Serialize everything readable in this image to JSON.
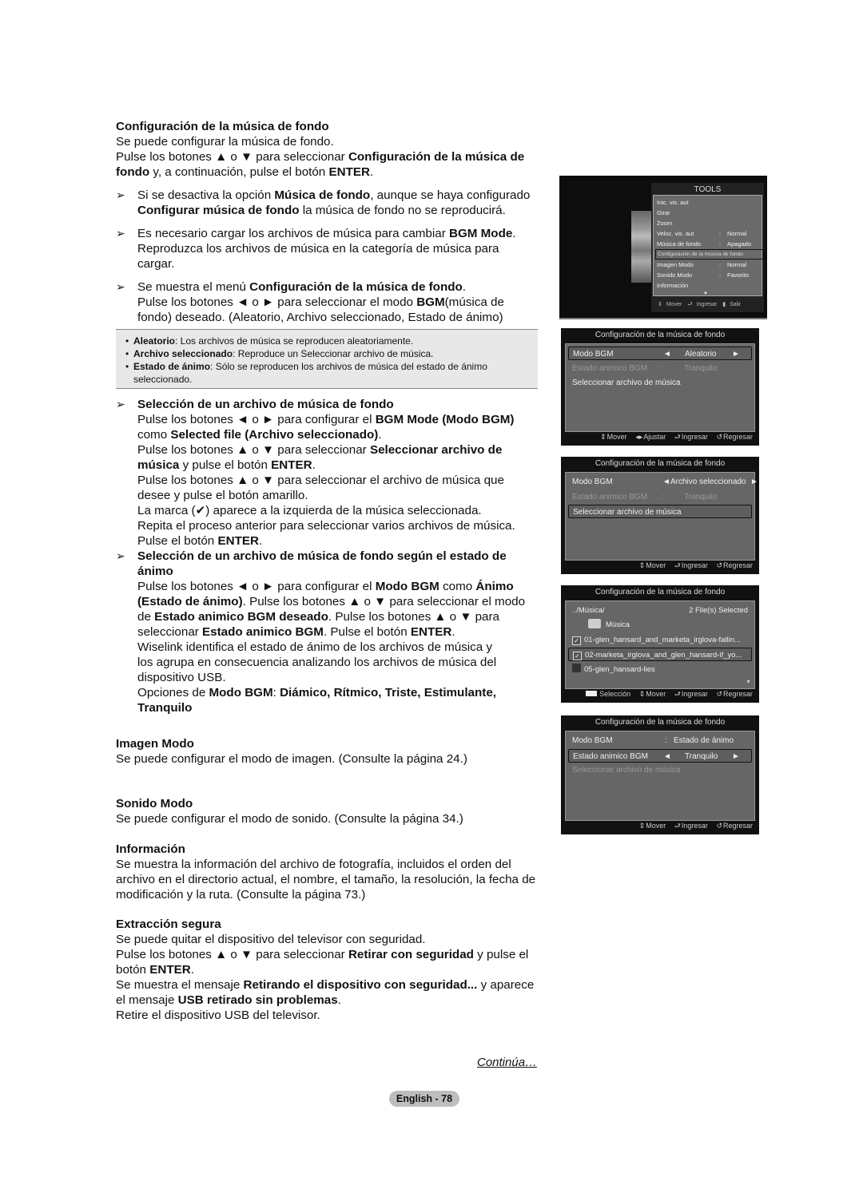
{
  "left": {
    "section1": {
      "heading": "Configuración de la música de fondo",
      "line1": "Se puede configurar la música de fondo.",
      "line2_a": "Pulse los botones ▲ o ▼ para seleccionar ",
      "line2_b": "Configuración de la música de",
      "line3_b": "fondo",
      "line3_a": " y, a continuación, pulse el botón ",
      "line3_c": "ENTER",
      "line3_d": "."
    },
    "notes": [
      {
        "p1a": "Si se desactiva la opción ",
        "p1b": "Música de fondo",
        "p1c": ", aunque se haya configurado",
        "p2a": "Configurar música de fondo",
        "p2b": " la música de fondo no se reproducirá."
      },
      {
        "p1a": "Es necesario cargar los archivos de música para cambiar ",
        "p1b": "BGM Mode",
        "p1c": ".",
        "p2": "Reproduzca los archivos de música en la categoría de música para",
        "p3": "cargar."
      },
      {
        "p1a": "Se muestra el menú ",
        "p1b": "Configuración de la música de fondo",
        "p1c": ".",
        "p2a": "Pulse los botones ◄ o ► para seleccionar el modo ",
        "p2b": "BGM",
        "p2c": "(música de",
        "p3": "fondo) deseado. (Aleatorio, Archivo seleccionado, Estado de ánimo)"
      }
    ],
    "bullets": [
      {
        "term": "Aleatorio",
        "text": ": Los archivos de música se reproducen aleatoriamente."
      },
      {
        "term": "Archivo seleccionado",
        "text": ": Reproduce un Seleccionar archivo de música."
      },
      {
        "term": "Estado de ánimo",
        "text": ": Sólo se reproducen los archivos de música del estado de ánimo",
        "text2": "seleccionado."
      }
    ],
    "select_file": {
      "heading": "Selección de un archivo de música de fondo",
      "l1a": "Pulse los botones ◄ o ► para configurar el ",
      "l1b": "BGM Mode (Modo BGM)",
      "l2a": "como ",
      "l2b": "Selected file (Archivo seleccionado)",
      "l2c": ".",
      "l3a": "Pulse los botones ▲ o ▼ para seleccionar ",
      "l3b": "Seleccionar archivo de",
      "l4a": "música",
      "l4b": " y pulse el botón ",
      "l4c": "ENTER",
      "l4d": ".",
      "l5": "Pulse los botones ▲ o ▼ para seleccionar el archivo de música que",
      "l6": "desee y pulse el botón amarillo.",
      "l7": "La marca (✔) aparece a la izquierda de la música seleccionada.",
      "l8": "Repita el proceso anterior para seleccionar varios archivos de música.",
      "l9a": "Pulse el botón ",
      "l9b": "ENTER",
      "l9c": "."
    },
    "mood": {
      "heading1": "Selección de un archivo de música de fondo según el estado de",
      "heading2": "ánimo",
      "l1a": "Pulse los botones ◄ o ► para configurar el ",
      "l1b": "Modo BGM",
      "l1c": " como ",
      "l1d": "Ánimo",
      "l2a": "(Estado de ánimo)",
      "l2b": ". Pulse los botones ▲ o ▼ para seleccionar el modo",
      "l3a": "de ",
      "l3b": "Estado animico BGM deseado",
      "l3c": ". Pulse los botones ▲ o ▼ para",
      "l4a": "seleccionar ",
      "l4b": "Estado animico BGM",
      "l4c": ". Pulse el botón ",
      "l4d": "ENTER",
      "l4e": ".",
      "l5": "Wiselink identifica el estado de ánimo de los archivos de música y",
      "l6": "los agrupa en consecuencia analizando los archivos de música del",
      "l7": "dispositivo USB.",
      "l8a": "Opciones de ",
      "l8b": "Modo BGM",
      "l8c": ": ",
      "l8d": "Diámico, Rítmico, Triste, Estimulante,",
      "l9": "Tranquilo"
    },
    "imagen": {
      "heading": "Imagen Modo",
      "text": "Se puede configurar el modo de imagen. (Consulte la página 24.)"
    },
    "sonido": {
      "heading": "Sonido Modo",
      "text": "Se puede configurar el modo de sonido. (Consulte la página 34.)"
    },
    "info": {
      "heading": "Información",
      "l1": "Se muestra la información del archivo de fotografía, incluidos el orden del",
      "l2": "archivo en el directorio actual, el nombre, el tamaño, la resolución, la fecha de",
      "l3": "modificación y la ruta. (Consulte la página 73.)"
    },
    "extract": {
      "heading": "Extracción segura",
      "l1": "Se puede quitar el dispositivo del televisor con seguridad.",
      "l2a": "Pulse los botones ▲ o ▼ para seleccionar ",
      "l2b": "Retirar con seguridad",
      "l2c": " y pulse el",
      "l3a": "botón ",
      "l3b": "ENTER",
      "l3c": ".",
      "l4a": "Se muestra el mensaje ",
      "l4b": "Retirando el dispositivo con seguridad...",
      "l4c": " y aparece",
      "l5a": "el mensaje ",
      "l5b": "USB retirado sin problemas",
      "l5c": ".",
      "l6": "Retire el dispositivo USB del televisor."
    },
    "note_arrow": "➢"
  },
  "tools_menu": {
    "title": "TOOLS",
    "items": [
      {
        "label": "Inic. vis. aut",
        "value": ""
      },
      {
        "label": "Girar",
        "value": ""
      },
      {
        "label": "Zoom",
        "value": ""
      },
      {
        "label": "Veloc. vis. aut",
        "value": "Normal"
      },
      {
        "label": "Música de fondo",
        "value": "Apagado"
      },
      {
        "label": "Configuración de la música de fondo",
        "value": "",
        "selected": true
      },
      {
        "label": "Imagen Modo",
        "value": "Normal"
      },
      {
        "label": "Sonido Modo",
        "value": "Favorito"
      },
      {
        "label": "Información",
        "value": ""
      }
    ],
    "footer": {
      "move": "Mover",
      "enter": "Ingresar",
      "exit": "Salir"
    }
  },
  "screens": [
    {
      "title": "Configuración de la música de fondo",
      "rows": [
        {
          "label": "Modo BGM",
          "value": "Aleatorio"
        },
        {
          "label": "Estado animico BGM",
          "value": "Tranquilo"
        },
        {
          "label": "Seleccionar archivo de música"
        }
      ],
      "footer": {
        "move": "Mover",
        "adjust": "Ajustar",
        "enter": "Ingresar",
        "back": "Regresar"
      }
    },
    {
      "title": "Configuración de la música de fondo",
      "rows": [
        {
          "label": "Modo BGM",
          "value": "Archivo seleccionado"
        },
        {
          "label": "Estado animico BGM",
          "value": "Tranquilo"
        },
        {
          "label": "Seleccionar archivo de música"
        }
      ],
      "footer": {
        "move": "Mover",
        "enter": "Ingresar",
        "back": "Regresar"
      }
    },
    {
      "title": "Configuración de la música de fondo",
      "path": "../Música/",
      "selected_count": "2 File(s) Selected",
      "folder": "Música",
      "files": [
        {
          "name": "01-glen_hansard_and_marketa_irglova-fallin...",
          "checked": true
        },
        {
          "name": "02-marketa_irglova_and_glen_hansard-if_yo...",
          "checked": true
        },
        {
          "name": "05-glen_hansard-lies",
          "checked": false
        }
      ],
      "footer": {
        "select": "Selección",
        "move": "Mover",
        "enter": "Ingresar",
        "back": "Regresar"
      }
    },
    {
      "title": "Configuración de la música de fondo",
      "rows": [
        {
          "label": "Modo BGM",
          "value": "Estado de ánimo"
        },
        {
          "label": "Estado animico BGM",
          "value": "Tranquilo"
        },
        {
          "label": "Seleccionar archivo de música"
        }
      ],
      "footer": {
        "move": "Mover",
        "enter": "Ingresar",
        "back": "Regresar"
      }
    }
  ],
  "continue_label": "Continúa…",
  "page_label": "English - 78"
}
